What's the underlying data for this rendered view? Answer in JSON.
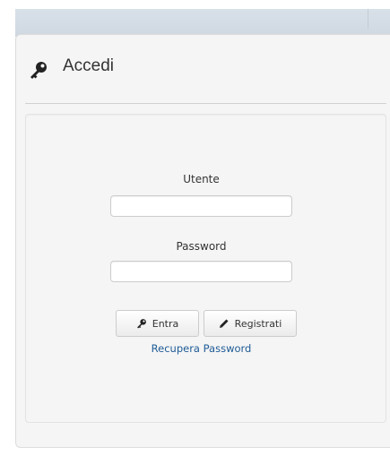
{
  "header": {
    "title": "Accedi",
    "icon": "key-icon"
  },
  "form": {
    "username_label": "Utente",
    "username_value": "",
    "password_label": "Password",
    "password_value": "",
    "login_button_label": "Entra",
    "login_button_icon": "key-icon",
    "register_button_label": "Registrati",
    "register_button_icon": "pencil-icon",
    "recover_link_label": "Recupera Password"
  },
  "colors": {
    "link": "#1f5b96",
    "panel_background": "#f5f5f5",
    "topbar_background": "#d3dce5"
  }
}
